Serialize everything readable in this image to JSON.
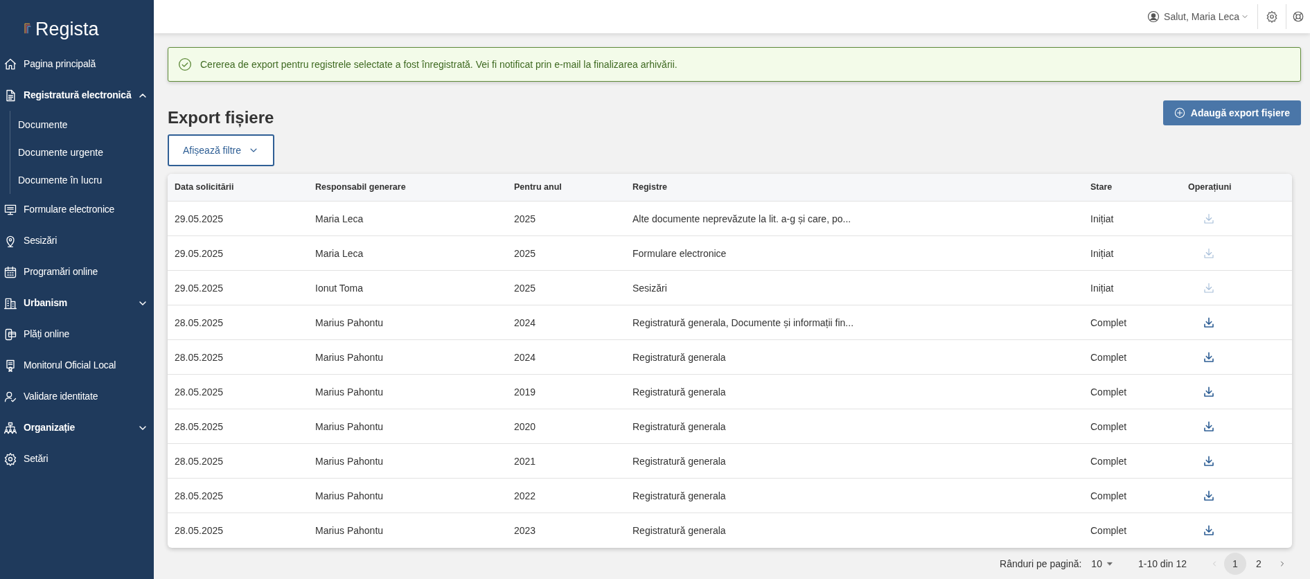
{
  "app": {
    "logo": "Regista"
  },
  "sidebar": {
    "items": [
      {
        "label": "Pagina principală"
      },
      {
        "label": "Registratură electronică",
        "expanded": true,
        "children": [
          {
            "label": "Documente"
          },
          {
            "label": "Documente urgente"
          },
          {
            "label": "Documente în lucru"
          }
        ]
      },
      {
        "label": "Formulare electronice"
      },
      {
        "label": "Sesizări"
      },
      {
        "label": "Programări online"
      },
      {
        "label": "Urbanism",
        "expanded": false
      },
      {
        "label": "Plăți online"
      },
      {
        "label": "Monitorul Oficial Local"
      },
      {
        "label": "Validare identitate"
      },
      {
        "label": "Organizație",
        "expanded": false
      },
      {
        "label": "Setări"
      }
    ]
  },
  "topbar": {
    "greeting": "Salut, Maria Leca"
  },
  "alert": {
    "message": "Cererea de export pentru registrele selectate a fost înregistrată. Vei fi notificat prin e-mail la finalizarea arhivării."
  },
  "page": {
    "title": "Export fișiere",
    "add_button": "Adaugă export fișiere",
    "filter_button": "Afișează filtre"
  },
  "table": {
    "columns": [
      "Data solicitării",
      "Responsabil generare",
      "Pentru anul",
      "Registre",
      "Stare",
      "Operațiuni"
    ],
    "rows": [
      {
        "cells": [
          "29.05.2025",
          "Maria Leca",
          "2025",
          "Alte documente neprevăzute la lit. a-g și care, po...",
          "Inițiat"
        ],
        "download_disabled": true
      },
      {
        "cells": [
          "29.05.2025",
          "Maria Leca",
          "2025",
          "Formulare electronice",
          "Inițiat"
        ],
        "download_disabled": true
      },
      {
        "cells": [
          "29.05.2025",
          "Ionut Toma",
          "2025",
          "Sesizări",
          "Inițiat"
        ],
        "download_disabled": true
      },
      {
        "cells": [
          "28.05.2025",
          "Marius Pahontu",
          "2024",
          "Registratură generala, Documente și informații fin...",
          "Complet"
        ],
        "download_disabled": false
      },
      {
        "cells": [
          "28.05.2025",
          "Marius Pahontu",
          "2024",
          "Registratură generala",
          "Complet"
        ],
        "download_disabled": false
      },
      {
        "cells": [
          "28.05.2025",
          "Marius Pahontu",
          "2019",
          "Registratură generala",
          "Complet"
        ],
        "download_disabled": false
      },
      {
        "cells": [
          "28.05.2025",
          "Marius Pahontu",
          "2020",
          "Registratură generala",
          "Complet"
        ],
        "download_disabled": false
      },
      {
        "cells": [
          "28.05.2025",
          "Marius Pahontu",
          "2021",
          "Registratură generala",
          "Complet"
        ],
        "download_disabled": false
      },
      {
        "cells": [
          "28.05.2025",
          "Marius Pahontu",
          "2022",
          "Registratură generala",
          "Complet"
        ],
        "download_disabled": false
      },
      {
        "cells": [
          "28.05.2025",
          "Marius Pahontu",
          "2023",
          "Registratură generala",
          "Complet"
        ],
        "download_disabled": false
      }
    ]
  },
  "pagination": {
    "rows_label": "Rânduri pe pagină:",
    "rows_per_page": "10",
    "range": "1-10 din 12",
    "pages": [
      {
        "label": "1",
        "selected": true
      },
      {
        "label": "2",
        "selected": false
      }
    ]
  }
}
